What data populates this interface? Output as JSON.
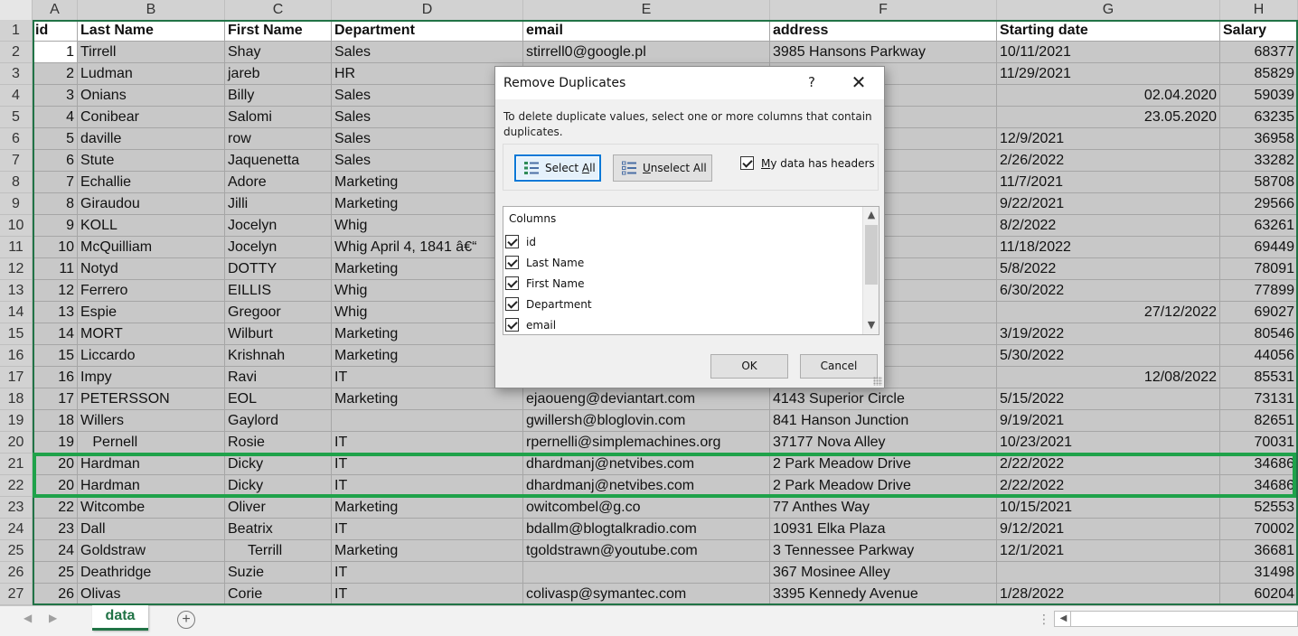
{
  "columns": [
    {
      "letter": "A"
    },
    {
      "letter": "B"
    },
    {
      "letter": "C"
    },
    {
      "letter": "D"
    },
    {
      "letter": "E"
    },
    {
      "letter": "F"
    },
    {
      "letter": "G"
    },
    {
      "letter": "H"
    }
  ],
  "rows": [
    {
      "num": "1",
      "cells": [
        "id",
        "Last Name",
        "First Name",
        "Department",
        "email",
        "address",
        "Starting date",
        "Salary"
      ]
    },
    {
      "num": "2",
      "cells": [
        "1",
        "Tirrell",
        "Shay",
        "Sales",
        "stirrell0@google.pl",
        "3985 Hansons Parkway",
        "10/11/2021",
        "68377"
      ]
    },
    {
      "num": "3",
      "cells": [
        "2",
        "Ludman",
        "jareb",
        "HR",
        "",
        "y",
        "11/29/2021",
        "85829"
      ]
    },
    {
      "num": "4",
      "cells": [
        "3",
        "Onians",
        "Billy",
        "Sales",
        "",
        "oad",
        "02.04.2020",
        "59039"
      ]
    },
    {
      "num": "5",
      "cells": [
        "4",
        "Conibear",
        "Salomi",
        "Sales",
        "",
        "",
        "23.05.2020",
        "63235"
      ]
    },
    {
      "num": "6",
      "cells": [
        "5",
        "daville",
        "row",
        "Sales",
        "",
        "r",
        "12/9/2021",
        "36958"
      ]
    },
    {
      "num": "7",
      "cells": [
        "6",
        "Stute",
        "Jaquenetta",
        "Sales",
        "",
        "ey",
        "2/26/2022",
        "33282"
      ]
    },
    {
      "num": "8",
      "cells": [
        "7",
        "Echallie",
        "Adore",
        "Marketing",
        "",
        "rossing",
        "11/7/2021",
        "58708"
      ]
    },
    {
      "num": "9",
      "cells": [
        "8",
        "Giraudou",
        "Jilli",
        "Marketing",
        "",
        "oad",
        "9/22/2021",
        "29566"
      ]
    },
    {
      "num": "10",
      "cells": [
        "9",
        "KOLL",
        "Jocelyn",
        "Whig",
        "",
        "Crossing",
        "8/2/2022",
        "63261"
      ]
    },
    {
      "num": "11",
      "cells": [
        "10",
        "McQuilliam",
        "Jocelyn",
        "Whig   April 4, 1841  â€“",
        "",
        "",
        "11/18/2022",
        "69449"
      ]
    },
    {
      "num": "12",
      "cells": [
        "11",
        "Notyd",
        "DOTTY",
        "Marketing",
        "",
        "Hill",
        "5/8/2022",
        "78091"
      ]
    },
    {
      "num": "13",
      "cells": [
        "12",
        "Ferrero",
        "EILLIS",
        "Whig",
        "",
        "",
        "6/30/2022",
        "77899"
      ]
    },
    {
      "num": "14",
      "cells": [
        "13",
        "Espie",
        "Gregoor",
        "Whig",
        "",
        "urt",
        "27/12/2022",
        "69027"
      ]
    },
    {
      "num": "15",
      "cells": [
        "14",
        "MORT",
        "Wilburt",
        "Marketing",
        "",
        "rdens Parkway",
        "3/19/2022",
        "80546"
      ]
    },
    {
      "num": "16",
      "cells": [
        "15",
        "Liccardo",
        "Krishnah",
        "Marketing",
        "",
        "er",
        "5/30/2022",
        "44056"
      ]
    },
    {
      "num": "17",
      "cells": [
        "16",
        "Impy",
        "Ravi",
        "IT",
        "",
        "Center",
        "12/08/2022",
        "85531"
      ]
    },
    {
      "num": "18",
      "cells": [
        "17",
        "PETERSSON",
        "EOL",
        "Marketing",
        "ejaoueng@deviantart.com",
        "4143 Superior Circle",
        "5/15/2022",
        "73131"
      ]
    },
    {
      "num": "19",
      "cells": [
        "18",
        "Willers",
        "Gaylord",
        "",
        "gwillersh@bloglovin.com",
        "841 Hanson Junction",
        "9/19/2021",
        "82651"
      ]
    },
    {
      "num": "20",
      "cells": [
        "19",
        "   Pernell",
        "Rosie",
        "IT",
        "rpernelli@simplemachines.org",
        "37177 Nova Alley",
        "10/23/2021",
        "70031"
      ]
    },
    {
      "num": "21",
      "cells": [
        "20",
        "Hardman",
        "Dicky",
        "IT",
        "dhardmanj@netvibes.com",
        "2 Park Meadow Drive",
        "2/22/2022",
        "34686"
      ]
    },
    {
      "num": "22",
      "cells": [
        "20",
        "Hardman",
        "Dicky",
        "IT",
        "dhardmanj@netvibes.com",
        "2 Park Meadow Drive",
        "2/22/2022",
        "34686"
      ]
    },
    {
      "num": "23",
      "cells": [
        "22",
        "Witcombe",
        "Oliver",
        "Marketing",
        "owitcombel@g.co",
        "77 Anthes Way",
        "10/15/2021",
        "52553"
      ]
    },
    {
      "num": "24",
      "cells": [
        "23",
        "Dall",
        "Beatrix",
        "IT",
        "bdallm@blogtalkradio.com",
        "10931 Elka Plaza",
        "9/12/2021",
        "70002"
      ]
    },
    {
      "num": "25",
      "cells": [
        "24",
        "Goldstraw",
        "     Terrill",
        "Marketing",
        "tgoldstrawn@youtube.com",
        "3 Tennessee Parkway",
        "12/1/2021",
        "36681"
      ]
    },
    {
      "num": "26",
      "cells": [
        "25",
        "Deathridge",
        "Suzie",
        "IT",
        "",
        "367 Mosinee Alley",
        "",
        "31498"
      ]
    },
    {
      "num": "27",
      "cells": [
        "26",
        "Olivas",
        "Corie",
        "IT",
        "colivasp@symantec.com",
        "3395 Kennedy Avenue",
        "1/28/2022",
        "60204"
      ]
    }
  ],
  "tabbar": {
    "sheet_tab": "data",
    "add_sheet": "+",
    "nav_left": "◀",
    "nav_right": "▶",
    "scroll_grip": "⋮",
    "scroll_left": "◀"
  },
  "dialog": {
    "title": "Remove Duplicates",
    "help": "?",
    "close": "✕",
    "description": "To delete duplicate values, select one or more columns that contain duplicates.",
    "select_all_prefix": "Select ",
    "select_all_key": "A",
    "select_all_suffix": "ll",
    "unselect_all_key": "U",
    "unselect_all_suffix": "nselect All",
    "headers_key": "M",
    "headers_suffix": "y data has headers",
    "columns_title": "Columns",
    "column_items": [
      "id",
      "Last Name",
      "First Name",
      "Department",
      "email"
    ],
    "ok": "OK",
    "cancel": "Cancel",
    "scroll_up": "▲",
    "scroll_down": "▼"
  }
}
